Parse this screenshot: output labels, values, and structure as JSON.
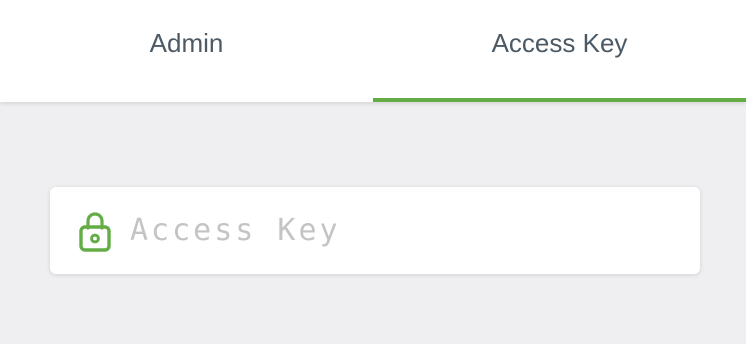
{
  "tabs": [
    {
      "label": "Admin",
      "active": false
    },
    {
      "label": "Access Key",
      "active": true
    }
  ],
  "access_key_field": {
    "placeholder": "Access Key",
    "value": "",
    "icon": "lock-icon"
  },
  "colors": {
    "accent": "#64ad46",
    "tab_text": "#4c5a66",
    "background": "#efeff1",
    "placeholder": "#c4c4c6"
  }
}
